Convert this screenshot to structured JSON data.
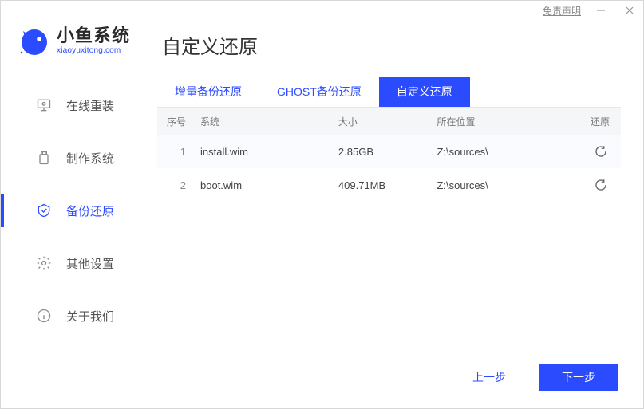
{
  "titlebar": {
    "disclaimer": "免责声明"
  },
  "logo": {
    "title": "小鱼系统",
    "sub": "xiaoyuxitong.com"
  },
  "nav": {
    "items": [
      {
        "label": "在线重装"
      },
      {
        "label": "制作系统"
      },
      {
        "label": "备份还原"
      },
      {
        "label": "其他设置"
      },
      {
        "label": "关于我们"
      }
    ]
  },
  "page": {
    "title": "自定义还原"
  },
  "tabs": [
    {
      "label": "增量备份还原"
    },
    {
      "label": "GHOST备份还原"
    },
    {
      "label": "自定义还原"
    }
  ],
  "table": {
    "headers": {
      "idx": "序号",
      "sys": "系统",
      "size": "大小",
      "loc": "所在位置",
      "act": "还原"
    },
    "rows": [
      {
        "idx": "1",
        "sys": "install.wim",
        "size": "2.85GB",
        "loc": "Z:\\sources\\"
      },
      {
        "idx": "2",
        "sys": "boot.wim",
        "size": "409.71MB",
        "loc": "Z:\\sources\\"
      }
    ]
  },
  "footer": {
    "prev": "上一步",
    "next": "下一步"
  },
  "colors": {
    "accent": "#2b4bff"
  }
}
